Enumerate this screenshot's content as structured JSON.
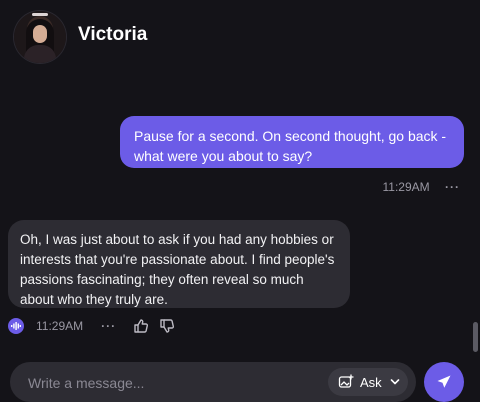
{
  "header": {
    "contact_name": "Victoria"
  },
  "messages": {
    "user": {
      "text": "Pause for a second. On second thought, go back - what were you about to say?",
      "time": "11:29AM",
      "more": "···"
    },
    "bot": {
      "text": "Oh, I was just about to ask if you had any hobbies or interests that you're passionate about. I find people's passions fascinating; they often reveal so much about who they truly are.",
      "time": "11:29AM",
      "more": "···"
    }
  },
  "composer": {
    "placeholder": "Write a message...",
    "value": "",
    "mode_label": "Ask"
  },
  "colors": {
    "background": "#141318",
    "accent": "#6c5ce7",
    "bubble_bot": "#2d2c33",
    "muted_text": "#9a98a3"
  }
}
